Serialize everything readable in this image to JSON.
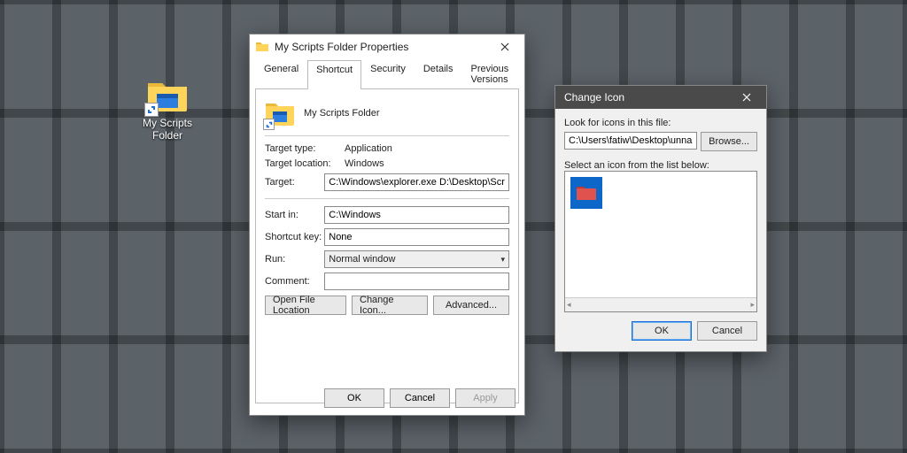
{
  "desktop": {
    "shortcut_label": "My Scripts Folder"
  },
  "properties": {
    "title": "My Scripts Folder Properties",
    "tabs": {
      "general": "General",
      "shortcut": "Shortcut",
      "security": "Security",
      "details": "Details",
      "previous": "Previous Versions"
    },
    "header_name": "My Scripts Folder",
    "labels": {
      "target_type": "Target type:",
      "target_location": "Target location:",
      "target": "Target:",
      "start_in": "Start in:",
      "shortcut_key": "Shortcut key:",
      "run": "Run:",
      "comment": "Comment:"
    },
    "values": {
      "target_type": "Application",
      "target_location": "Windows",
      "target": "C:\\Windows\\explorer.exe D:\\Desktop\\Scripts",
      "start_in": "C:\\Windows",
      "shortcut_key": "None",
      "run": "Normal window",
      "comment": ""
    },
    "buttons": {
      "open_location": "Open File Location",
      "change_icon": "Change Icon...",
      "advanced": "Advanced...",
      "ok": "OK",
      "cancel": "Cancel",
      "apply": "Apply"
    }
  },
  "change_icon": {
    "title": "Change Icon",
    "look_label": "Look for icons in this file:",
    "path": "C:\\Users\\fatiw\\Desktop\\unnamed_cy",
    "browse": "Browse...",
    "select_label": "Select an icon from the list below:",
    "ok": "OK",
    "cancel": "Cancel"
  }
}
